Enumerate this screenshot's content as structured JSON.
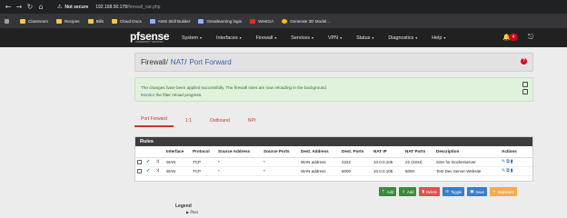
{
  "browser": {
    "security_label": "Not secure",
    "url_host": "192.168.50.178",
    "url_path": "/firewall_nat.php",
    "bookmarks": [
      "Classroom",
      "Recipes",
      "Bills",
      "Cloud Docs",
      "AWS Skill Builder",
      "Greatlearning login",
      "WestGA",
      "Generate 3D Model..."
    ]
  },
  "navbar": {
    "logo_text": "pfsense",
    "logo_sub": "COMMUNITY EDITION",
    "menu": [
      "System",
      "Interfaces",
      "Firewall",
      "Services",
      "VPN",
      "Status",
      "Diagnostics",
      "Help"
    ],
    "notification_count": "4"
  },
  "breadcrumb": [
    "Firewall",
    "NAT",
    "Port Forward"
  ],
  "alert": {
    "line1": "The changes have been applied successfully. The firewall rules are now reloading in the background.",
    "link": "Monitor",
    "line2_rest": " the filter reload progress."
  },
  "tabs": [
    "Port Forward",
    "1:1",
    "Outbound",
    "NPt"
  ],
  "rules": {
    "title": "Rules",
    "columns": [
      "",
      "",
      "",
      "Interface",
      "Protocol",
      "Source Address",
      "Source Ports",
      "Dest. Address",
      "Dest. Ports",
      "NAT IP",
      "NAT Ports",
      "Description",
      "Actions"
    ],
    "rows": [
      {
        "interface": "WAN",
        "protocol": "TCP",
        "src_addr": "*",
        "src_ports": "*",
        "dest_addr": "WAN address",
        "dest_ports": "2222",
        "nat_ip": "10.0.0.105",
        "nat_ports": "22 (SSH)",
        "description": "SSH for Dockerserver"
      },
      {
        "interface": "WAN",
        "protocol": "TCP",
        "src_addr": "*",
        "src_ports": "*",
        "dest_addr": "WAN address",
        "dest_ports": "5000",
        "nat_ip": "10.0.0.105",
        "nat_ports": "5000",
        "description": "Test Dev Server Website"
      }
    ]
  },
  "buttons": [
    "Add",
    "Add",
    "Delete",
    "Toggle",
    "Save",
    "Separator"
  ],
  "legend": {
    "title": "Legend",
    "item": "Pass"
  },
  "colors": {
    "navbar": "#212121",
    "accent_red": "#c0392b",
    "success_bg": "#e1f2dc"
  }
}
